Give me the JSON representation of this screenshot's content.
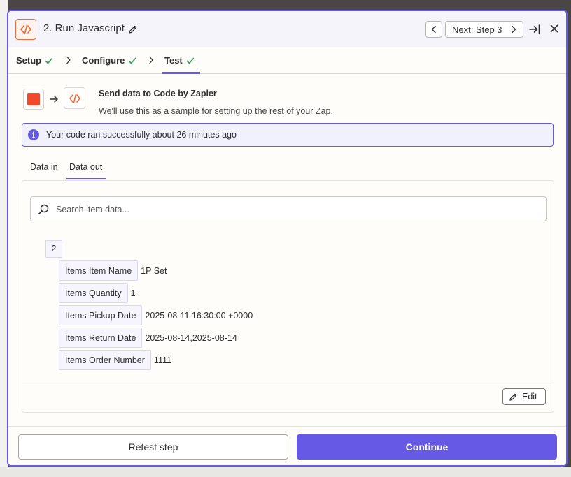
{
  "header": {
    "title": "2. Run Javascript",
    "next_label": "Next: Step 3"
  },
  "steps": [
    {
      "label": "Setup"
    },
    {
      "label": "Configure"
    },
    {
      "label": "Test"
    }
  ],
  "send": {
    "title": "Send data to Code by Zapier",
    "subtitle": "We'll use this as a sample for setting up the rest of your Zap."
  },
  "alert": {
    "text": "Your code ran successfully about 26 minutes ago"
  },
  "tabs": [
    {
      "label": "Data in"
    },
    {
      "label": "Data out"
    }
  ],
  "search": {
    "placeholder": "Search item data..."
  },
  "data_out": {
    "index": "2",
    "items": [
      {
        "key": "Items Item Name",
        "value": "1P Set"
      },
      {
        "key": "Items Quantity",
        "value": "1"
      },
      {
        "key": "Items Pickup Date",
        "value": "2025-08-11 16:30:00 +0000"
      },
      {
        "key": "Items Return Date",
        "value": "2025-08-14,2025-08-14"
      },
      {
        "key": "Items Order Number",
        "value": "1111"
      }
    ]
  },
  "edit_label": "Edit",
  "footer": {
    "retest_label": "Retest step",
    "continue_label": "Continue"
  },
  "colors": {
    "accent": "#6559e6",
    "success": "#2e9b5b",
    "brand_orange": "#f06a3b",
    "brand_red": "#f0492b"
  }
}
